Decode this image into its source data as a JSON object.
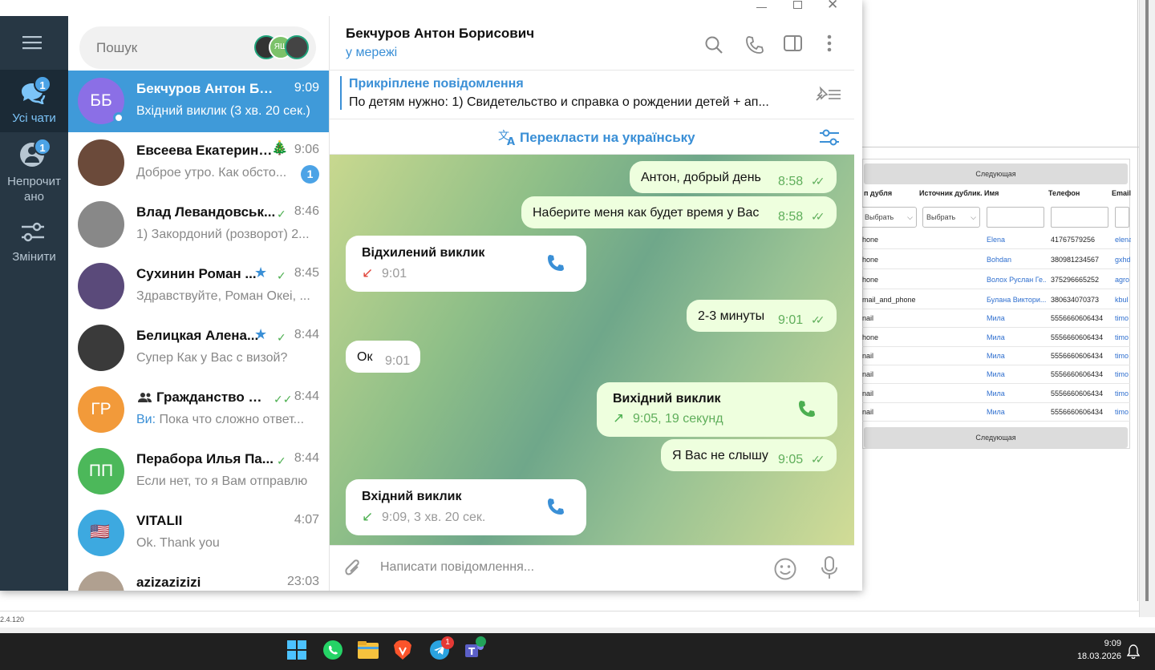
{
  "window": {
    "controls": [
      "minimize",
      "maximize",
      "close"
    ]
  },
  "rail": {
    "items": [
      {
        "label": "Усі чати",
        "badge": "1",
        "active": true
      },
      {
        "label": "Непрочитано",
        "label_l1": "Непрочит",
        "label_l2": "ано",
        "badge": "1",
        "active": false
      },
      {
        "label": "Змінити",
        "active": false
      }
    ]
  },
  "search": {
    "placeholder": "Пошук",
    "avatar_text": "ЯШ"
  },
  "chats": [
    {
      "initials": "ББ",
      "name": "Бекчуров Антон Бори...",
      "time": "9:09",
      "preview": "Вхідний виклик (3 хв. 20 сек.)",
      "active": true,
      "color": "#8b6fe6"
    },
    {
      "name": "Евсеева Екатерина...",
      "time": "9:06",
      "preview": "Доброе утро. Как обсто...",
      "unread": "1",
      "color": "#6b4a3a"
    },
    {
      "name": "Влад Левандовськ...",
      "time": "8:46",
      "preview": "1) Закордоний (розворот) 2...",
      "read": true,
      "color": "#888"
    },
    {
      "name": "Сухинин Роман ...",
      "time": "8:45",
      "preview": "Здравствуйте, Роман Океі, ...",
      "read": true,
      "starred": true,
      "color": "#5a4a7a"
    },
    {
      "name": "Белицкая Алена...",
      "time": "8:44",
      "preview": "Супер Как у Вас с визой?",
      "read": true,
      "starred": true,
      "color": "#3a3a3a"
    },
    {
      "initials": "ГР",
      "name": "Гражданство Ру...",
      "time": "8:44",
      "preview_prefix": "Ви:",
      "preview": "Пока что сложно ответ...",
      "read": true,
      "group": true,
      "color": "#f29a3a"
    },
    {
      "initials": "ПП",
      "name": "Перабора Илья Па...",
      "time": "8:44",
      "preview": "Если нет, то я Вам отправлю",
      "read": true,
      "color": "#4cb85a"
    },
    {
      "name": "VITALII",
      "time": "4:07",
      "preview": "Ok. Thank you",
      "color": "#3da9e0"
    },
    {
      "name": "azizazizizi",
      "time": "23:03",
      "preview": "",
      "color": "#b0a090"
    }
  ],
  "header": {
    "title": "Бекчуров Антон Борисович",
    "status": "у мережі"
  },
  "pinned": {
    "title": "Прикріплене повідомлення",
    "text": "По детям нужно:  1) Свидетельство и справка о рождении детей + ап..."
  },
  "translate": {
    "label": "Перекласти на українську"
  },
  "messages": [
    {
      "dir": "out",
      "text": "Антон, добрый день",
      "time": "8:58"
    },
    {
      "dir": "out",
      "text": "Наберите меня как будет время у Вас",
      "time": "8:58"
    },
    {
      "dir": "in",
      "call": true,
      "title": "Відхилений виклик",
      "time": "9:01"
    },
    {
      "dir": "out",
      "text": "2-3 минуты",
      "time": "9:01"
    },
    {
      "dir": "in",
      "text": "Ок",
      "time": "9:01"
    },
    {
      "dir": "out",
      "call": true,
      "title": "Вихідний виклик",
      "time": "9:05, 19 секунд"
    },
    {
      "dir": "out",
      "text": "Я Вас не слышу",
      "time": "9:05"
    },
    {
      "dir": "in",
      "call": true,
      "title": "Вхідний виклик",
      "time": "9:09, 3 хв. 20 сек."
    }
  ],
  "compose": {
    "placeholder": "Написати повідомлення..."
  },
  "bgapp": {
    "next_label": "Следующая",
    "headers": [
      "п дубля",
      "Источник дублик...",
      "Имя",
      "Телефон",
      "Email"
    ],
    "select_label": "Выбрать",
    "rows": [
      {
        "type": "hone",
        "name": "Elena",
        "phone": "41767579256",
        "email": "elena"
      },
      {
        "type": "hone",
        "name": "Bohdan",
        "phone": "380981234567",
        "email": "gxhd"
      },
      {
        "type": "hone",
        "name": "Волох Руслан Ге...",
        "phone": "375296665252",
        "email": "agro"
      },
      {
        "type": "mail_and_phone",
        "name": "Булана Виктори...",
        "phone": "380634070373",
        "email": "kbul"
      },
      {
        "type": "nail",
        "name": "Мила",
        "phone": "5556660606434",
        "email": "timo"
      },
      {
        "type": "hone",
        "name": "Мила",
        "phone": "5556660606434",
        "email": "timo"
      },
      {
        "type": "nail",
        "name": "Мила",
        "phone": "5556660606434",
        "email": "timo"
      },
      {
        "type": "nail",
        "name": "Мила",
        "phone": "5556660606434",
        "email": "timo"
      },
      {
        "type": "nail",
        "name": "Мила",
        "phone": "5556660606434",
        "email": "timo"
      },
      {
        "type": "nail",
        "name": "Мила",
        "phone": "5556660606434",
        "email": "timo"
      }
    ],
    "version": "2.4.120"
  },
  "taskbar": {
    "time": "9:09",
    "date": "18.03.2026",
    "telegram_badge": "1"
  }
}
